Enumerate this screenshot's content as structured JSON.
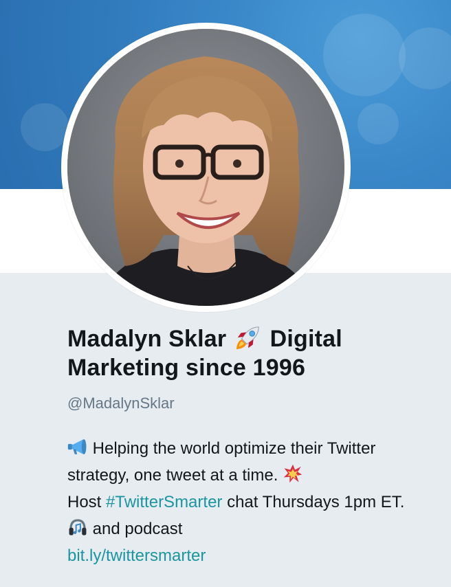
{
  "profile": {
    "name_part1": "Madalyn Sklar",
    "name_emoji": "rocket-icon",
    "name_part2": "Digital Marketing since 1996",
    "handle": "@MadalynSklar"
  },
  "bio": {
    "seg1": "Helping the world optimize their Twitter strategy, one tweet at a time.",
    "seg2": "Host",
    "hashtag": "#TwitterSmarter",
    "seg3": "chat Thursdays 1pm ET.",
    "seg4": "and podcast",
    "link": "bit.ly/twittersmarter"
  },
  "icons": {
    "megaphone": "megaphone-icon",
    "collision": "collision-icon",
    "headphones": "headphones-icon"
  },
  "colors": {
    "banner": "#2f78ba",
    "background": "#e6ecf0",
    "name": "#14171a",
    "handle": "#657786",
    "link": "#1b95a0"
  }
}
